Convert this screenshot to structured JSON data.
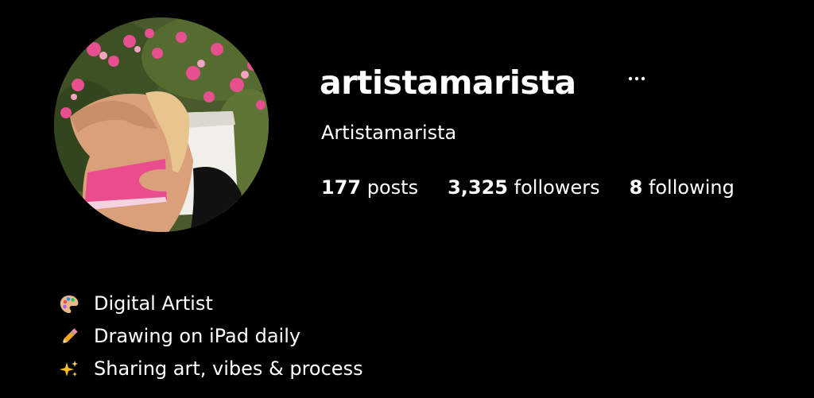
{
  "profile": {
    "username": "artistamarista",
    "display_name": "Artistamarista",
    "more_icon": "ellipsis-icon",
    "avatar_icon": "profile-photo"
  },
  "stats": {
    "posts": {
      "count": "177",
      "label": "posts"
    },
    "followers": {
      "count": "3,325",
      "label": "followers"
    },
    "following": {
      "count": "8",
      "label": "following"
    }
  },
  "bio": {
    "lines": [
      {
        "icon": "palette-emoji",
        "text": "Digital Artist"
      },
      {
        "icon": "pencil-emoji",
        "text": "Drawing on iPad daily"
      },
      {
        "icon": "sparkles-emoji",
        "text": "Sharing art, vibes & process"
      }
    ]
  },
  "colors": {
    "background": "#000000",
    "text": "#ffffff",
    "accent_pink": "#e6508f"
  }
}
